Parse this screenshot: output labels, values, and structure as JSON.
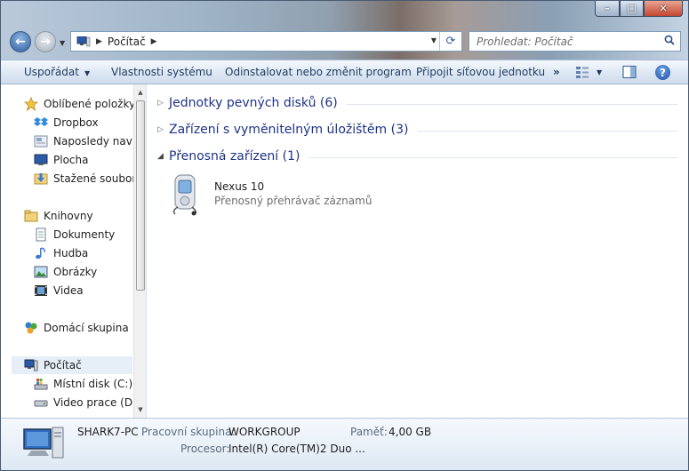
{
  "window": {
    "caption": {
      "minimize": "–",
      "maximize": "□",
      "close": "✕"
    }
  },
  "nav": {
    "back_icon": "back-arrow-icon",
    "forward_icon": "forward-arrow-icon",
    "breadcrumb": [
      "Počítač"
    ],
    "search_placeholder": "Prohledat: Počítač"
  },
  "toolbar": {
    "organize": "Uspořádat",
    "system_properties": "Vlastnosti systému",
    "uninstall": "Odinstalovat nebo změnit program",
    "map_drive": "Připojit síťovou jednotku",
    "more": "»",
    "help": "?"
  },
  "sidebar": {
    "items": [
      {
        "label": "Oblíbené položky",
        "icon": "star-icon"
      },
      {
        "label": "Dropbox",
        "icon": "dropbox-icon"
      },
      {
        "label": "Naposledy navštívené",
        "icon": "recent-places-icon"
      },
      {
        "label": "Plocha",
        "icon": "desktop-icon"
      },
      {
        "label": "Stažené soubory",
        "icon": "downloads-icon"
      },
      {
        "label": "Knihovny",
        "icon": "libraries-icon"
      },
      {
        "label": "Dokumenty",
        "icon": "documents-icon"
      },
      {
        "label": "Hudba",
        "icon": "music-icon"
      },
      {
        "label": "Obrázky",
        "icon": "pictures-icon"
      },
      {
        "label": "Videa",
        "icon": "videos-icon"
      },
      {
        "label": "Domácí skupina",
        "icon": "homegroup-icon"
      },
      {
        "label": "Počítač",
        "icon": "computer-icon"
      },
      {
        "label": "Místní disk (C:)",
        "icon": "local-disk-icon"
      },
      {
        "label": "Video prace (D:)",
        "icon": "drive-icon"
      }
    ]
  },
  "main": {
    "groups": [
      {
        "title": "Jednotky pevných disků (6)",
        "expanded": false
      },
      {
        "title": "Zařízení s vyměnitelným úložištěm (3)",
        "expanded": false
      },
      {
        "title": "Přenosná zařízení (1)",
        "expanded": true
      }
    ],
    "device": {
      "name": "Nexus 10",
      "description": "Přenosný přehrávač záznamů"
    }
  },
  "details": {
    "computer_name": "SHARK7-PC",
    "workgroup_label": "Pracovní skupina:",
    "workgroup_value": "WORKGROUP",
    "memory_label": "Paměť:",
    "memory_value": "4,00 GB",
    "processor_label": "Procesor:",
    "processor_value": "Intel(R) Core(TM)2 Duo ..."
  },
  "colors": {
    "group_title": "#1e3287",
    "toolbar_text": "#1e3b5f",
    "selection": "#e6eef7"
  }
}
